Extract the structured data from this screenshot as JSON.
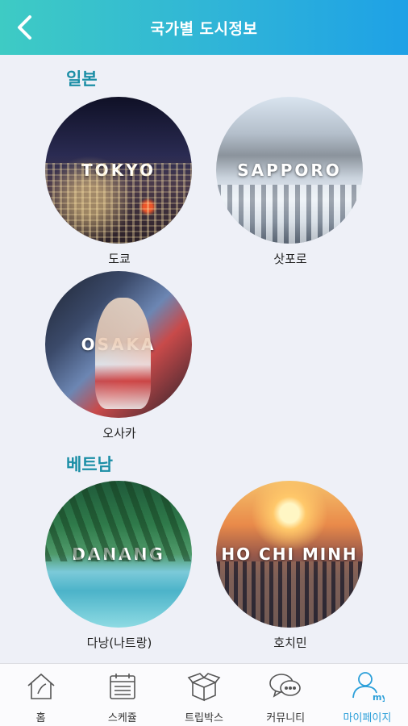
{
  "header": {
    "title": "국가별 도시정보"
  },
  "sections": [
    {
      "title": "일본",
      "cities": [
        {
          "en": "TOKYO",
          "ko": "도쿄"
        },
        {
          "en": "SAPPORO",
          "ko": "삿포로"
        },
        {
          "en": "OSAKA",
          "ko": "오사카"
        }
      ]
    },
    {
      "title": "베트남",
      "cities": [
        {
          "en": "DANANG",
          "ko": "다낭(나트랑)"
        },
        {
          "en": "HO CHI MINH",
          "ko": "호치민"
        }
      ]
    }
  ],
  "tabs": [
    {
      "label": "홈",
      "icon": "home-icon"
    },
    {
      "label": "스케쥴",
      "icon": "calendar-icon"
    },
    {
      "label": "트립박스",
      "icon": "box-icon"
    },
    {
      "label": "커뮤니티",
      "icon": "chat-icon"
    },
    {
      "label": "마이페이지",
      "icon": "user-icon"
    }
  ],
  "colors": {
    "accent": "#2b9fd9",
    "section_title": "#1b8ea6"
  }
}
